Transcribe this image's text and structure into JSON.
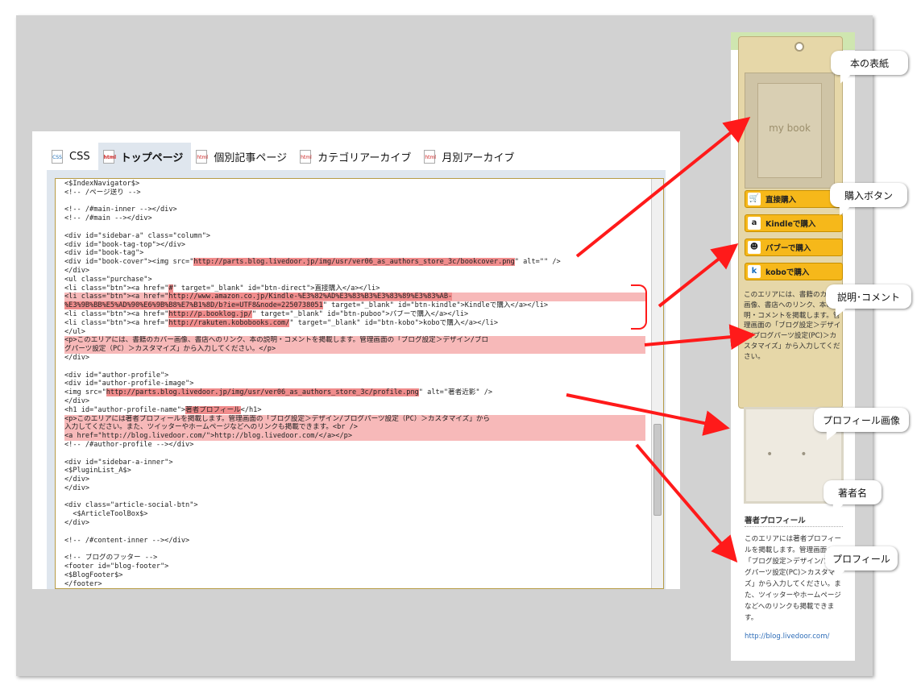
{
  "editor": {
    "tabs": [
      {
        "icon": "css",
        "label": "CSS"
      },
      {
        "icon": "html",
        "label": "トップページ"
      },
      {
        "icon": "html",
        "label": "個別記事ページ"
      },
      {
        "icon": "html",
        "label": "カテゴリアーカイブ"
      },
      {
        "icon": "html",
        "label": "月別アーカイブ"
      }
    ],
    "active_tab": "トップページ",
    "code_lines": [
      {
        "text": "<$IndexNavigator$>"
      },
      {
        "text": "<!-- /ページ送り -->"
      },
      {
        "text": ""
      },
      {
        "text": "<!-- /#main-inner --></div>"
      },
      {
        "text": "<!-- /#main --></div>"
      },
      {
        "text": ""
      },
      {
        "text": "<div id=\"sidebar-a\" class=\"column\">"
      },
      {
        "text": "<div id=\"book-tag-top\"></div>"
      },
      {
        "text": "<div id=\"book-tag\">"
      },
      {
        "text": "<div id=\"book-cover\"><img src=\"",
        "mark": "http://parts.blog.livedoor.jp/img/usr/ver06_as_authors_store_3c/bookcover.png",
        "after": "\" alt=\"\" />"
      },
      {
        "text": "</div>"
      },
      {
        "text": "<ul class=\"purchase\">"
      },
      {
        "text": "<li class=\"btn\"><a href=\"",
        "mark": "#",
        "after": "\" target=\"_blank\" id=\"btn-direct\">直接購入</a></li>"
      },
      {
        "text": "<li class=\"btn\"><a href=\"",
        "mark": "http://www.amazon.co.jp/Kindle-%E3%82%AD%E3%83%B3%E3%83%89%E3%83%AB-",
        "hl": true
      },
      {
        "text": "",
        "mark": "%E3%9B%BB%E5%AD%90%E6%9B%B8%E7%B1%8D/b?ie=UTF8&node=2250738051",
        "after": "\" target=\"_blank\" id=\"btn-kindle\">Kindleで購入</a></li>"
      },
      {
        "text": "<li class=\"btn\"><a href=\"",
        "mark": "http://p.booklog.jp/",
        "after": "\" target=\"_blank\" id=\"btn-puboo\">パブーで購入</a></li>"
      },
      {
        "text": "<li class=\"btn\"><a href=\"",
        "mark": "http://rakuten.kobobooks.com/",
        "after": "\" target=\"_blank\" id=\"btn-kobo\">koboで購入</a></li>"
      },
      {
        "text": "</ul>"
      },
      {
        "text": "<p>このエリアには、書籍のカバー画像、書店へのリンク、本の説明・コメントを掲載します。管理画面の「ブログ設定＞デザイン/ブロ",
        "hl": true
      },
      {
        "text": "グパーツ設定（PC）＞カスタマイズ」から入力してください。</p>",
        "hl": true
      },
      {
        "text": "</div>"
      },
      {
        "text": ""
      },
      {
        "text": "<div id=\"author-profile\">"
      },
      {
        "text": "<div id=\"author-profile-image\">"
      },
      {
        "text": "<img src=\"",
        "mark": "http://parts.blog.livedoor.jp/img/usr/ver06_as_authors_store_3c/profile.png",
        "after": "\" alt=\"著者近影\" />"
      },
      {
        "text": "</div>"
      },
      {
        "text": "<h1 id=\"author-profile-name\">",
        "mark": "著者プロフィール",
        "after": "</h1>"
      },
      {
        "text": "<p>このエリアには著者プロフィールを掲載します。管理画面の「ブログ設定＞デザイン/ブログパーツ設定（PC）＞カスタマイズ」から",
        "hl": true
      },
      {
        "text": "入力してください。また、ツイッターやホームページなどへのリンクも掲載できます。<br />",
        "hl": true
      },
      {
        "text": "<a href=\"http://blog.livedoor.com/\">http://blog.livedoor.com/</a></p>",
        "hl": true
      },
      {
        "text": "<!-- /#author-profile --></div>"
      },
      {
        "text": ""
      },
      {
        "text": "<div id=\"sidebar-a-inner\">"
      },
      {
        "text": "<$PluginList_A$>"
      },
      {
        "text": "</div>"
      },
      {
        "text": "</div>"
      },
      {
        "text": ""
      },
      {
        "text": "<div class=\"article-social-btn\">"
      },
      {
        "text": "  <$ArticleToolBox$>"
      },
      {
        "text": "</div>"
      },
      {
        "text": ""
      },
      {
        "text": "<!-- /#content-inner --></div>"
      },
      {
        "text": ""
      },
      {
        "text": "<!-- ブログのフッター -->"
      },
      {
        "text": "<footer id=\"blog-footer\">"
      },
      {
        "text": "<$BlogFooter$>"
      },
      {
        "text": "</footer>"
      }
    ]
  },
  "sidebar": {
    "book_cover_text": "my book",
    "buy_buttons": [
      {
        "icon": "cart",
        "label": "直接購入"
      },
      {
        "icon": "amazon",
        "label": "Kindleで購入"
      },
      {
        "icon": "puboo",
        "label": "パブーで購入"
      },
      {
        "icon": "kobo",
        "label": "koboで購入"
      }
    ],
    "description": "このエリアには、書籍のカバー画像、書店へのリンク、本の説明・コメントを掲載します。管理画面の「ブログ設定＞デザイン/ブログパーツ設定(PC)＞カスタマイズ」から入力してください。",
    "author_name": "著者プロフィール",
    "author_text": "このエリアには著者プロフィールを掲載します。管理画面の「ブログ設定＞デザイン/ブログパーツ設定(PC)＞カスタマイズ」から入力してください。また、ツイッターやホームページなどへのリンクも掲載できます。",
    "author_link": "http://blog.livedoor.com/"
  },
  "callouts": [
    {
      "name": "callout-book-cover",
      "label": "本の表紙"
    },
    {
      "name": "callout-buy-buttons",
      "label": "購入ボタン"
    },
    {
      "name": "callout-description",
      "label": "説明･コメント"
    },
    {
      "name": "callout-profile-image",
      "label": "プロフィール画像"
    },
    {
      "name": "callout-author-name",
      "label": "著者名"
    },
    {
      "name": "callout-profile",
      "label": "プロフィール"
    }
  ],
  "colors": {
    "canvas": "#d2d2d2",
    "highlight_line": "#f7b9b9",
    "highlight_url": "#f08c8c",
    "arrow": "#ff1a1a",
    "buy_button": "#f6b81a"
  }
}
